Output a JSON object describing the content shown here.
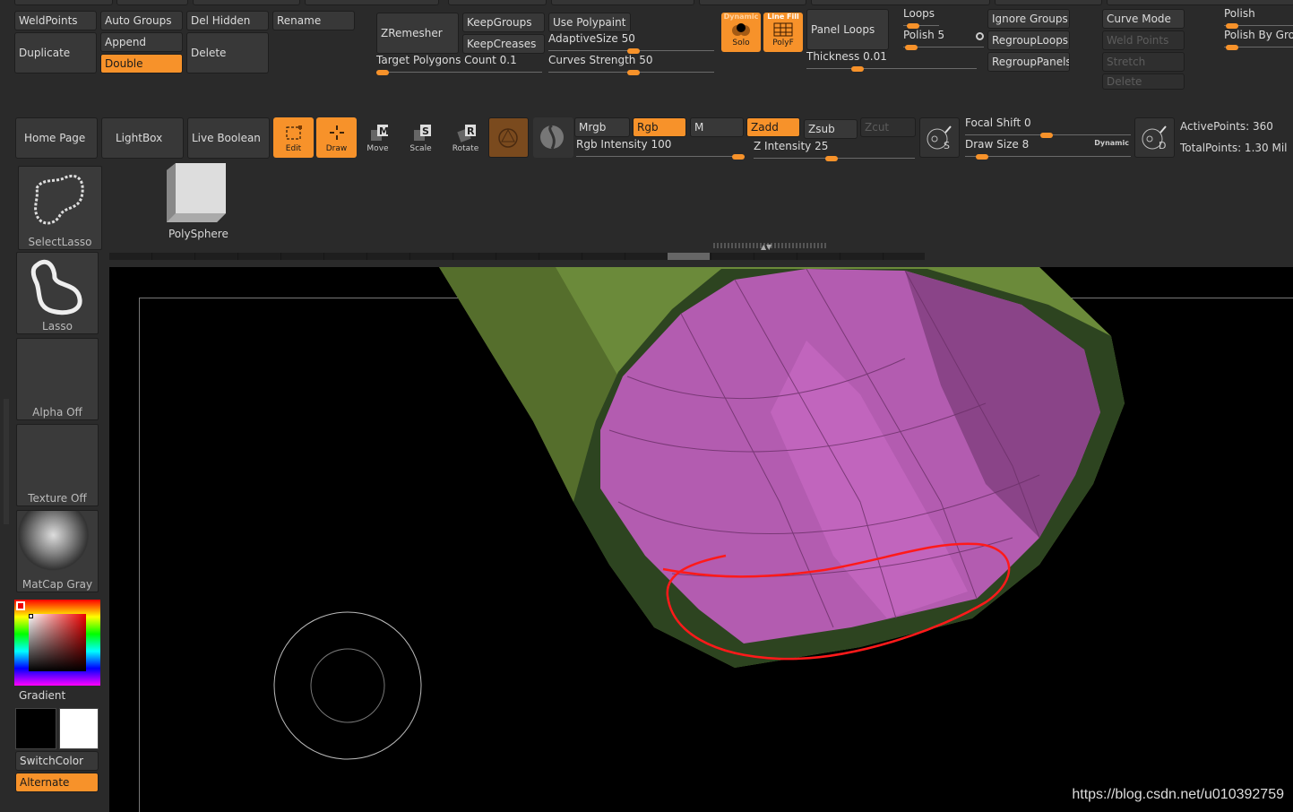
{
  "geometry": {
    "weldpoints": "WeldPoints",
    "auto_groups": "Auto Groups",
    "del_hidden": "Del Hidden",
    "rename": "Rename",
    "duplicate": "Duplicate",
    "append": "Append",
    "double": "Double",
    "delete": "Delete"
  },
  "zremesher": {
    "zremesher": "ZRemesher",
    "keep_groups": "KeepGroups",
    "keep_creases": "KeepCreases",
    "use_polypaint": "Use Polypaint",
    "adaptive_size": "AdaptiveSize",
    "adaptive_size_value": "50",
    "target_polygons": "Target Polygons Count",
    "target_polygons_value": "0.1",
    "curves_strength": "Curves Strength",
    "curves_strength_value": "50"
  },
  "dynamic": {
    "dynamic_label": "Dynamic",
    "solo": "Solo",
    "line_fill": "Line Fill",
    "polyf": "PolyF"
  },
  "panel_loops": {
    "panel_loops": "Panel Loops",
    "thickness": "Thickness",
    "thickness_value": "0.01",
    "loops": "Loops",
    "polish": "Polish",
    "polish_value": "5",
    "ignore_groups": "Ignore Groups",
    "regroup_loops": "RegroupLoops",
    "regroup_panels": "RegroupPanels"
  },
  "curve": {
    "curve_mode": "Curve Mode",
    "weld_points": "Weld Points",
    "stretch": "Stretch",
    "delete": "Delete"
  },
  "polish_panel": {
    "polish": "Polish",
    "polish_by_groups": "Polish By Gro"
  },
  "toolbar": {
    "home_page": "Home Page",
    "lightbox": "LightBox",
    "live_boolean": "Live Boolean",
    "edit": "Edit",
    "draw": "Draw",
    "move": "Move",
    "scale": "Scale",
    "rotate": "Rotate",
    "mrgb": "Mrgb",
    "rgb": "Rgb",
    "m": "M",
    "zadd": "Zadd",
    "zsub": "Zsub",
    "zcut": "Zcut",
    "rgb_intensity": "Rgb Intensity",
    "rgb_intensity_value": "100",
    "z_intensity": "Z Intensity",
    "z_intensity_value": "25",
    "focal_shift": "Focal Shift",
    "focal_shift_value": "0",
    "draw_size": "Draw Size",
    "draw_size_value": "8",
    "dynamic": "Dynamic",
    "active_points": "ActivePoints: 360",
    "total_points": "TotalPoints: 1.30 Mil",
    "focal_icon_letter": "S",
    "draw_icon_letter": "D"
  },
  "left": {
    "select_lasso": "SelectLasso",
    "lasso": "Lasso",
    "alpha": "Alpha Off",
    "texture": "Texture Off",
    "matcap": "MatCap Gray",
    "gradient": "Gradient",
    "switch_color": "SwitchColor",
    "alternate": "Alternate"
  },
  "tool": {
    "polysphere": "PolySphere"
  },
  "watermark": "https://blog.csdn.net/u010392759",
  "colors": {
    "accent": "#f7922a",
    "panel": "#383838",
    "background": "#2a2a2a",
    "mesh_green": "#6b8a3a",
    "mesh_pink": "#b35cb0",
    "stroke_red": "#ff1a1a"
  }
}
